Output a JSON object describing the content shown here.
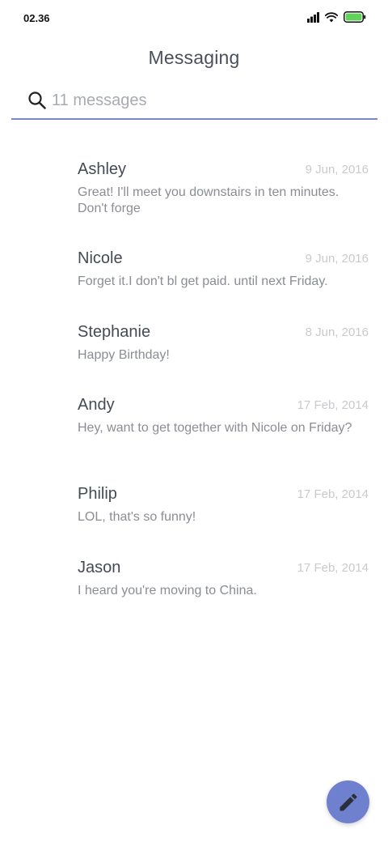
{
  "status_bar": {
    "time": "02.36",
    "signal_icon": "signal-icon",
    "wifi_icon": "wifi-icon",
    "battery_icon": "battery-icon",
    "battery_color": "#5fd35a"
  },
  "header": {
    "title": "Messaging"
  },
  "search": {
    "placeholder": "11 messages",
    "value": "",
    "icon": "search-icon",
    "accent": "#7a89cc"
  },
  "messages": [
    {
      "name": "Ashley",
      "date": "9 Jun, 2016",
      "preview": "Great! I'll meet you downstairs in ten minutes. Don't forge"
    },
    {
      "name": "Nicole",
      "date": "9 Jun, 2016",
      "preview": "Forget it.I don't bl get paid. until next Friday."
    },
    {
      "name": "Stephanie",
      "date": "8 Jun, 2016",
      "preview": "Happy Birthday!"
    },
    {
      "name": "Andy",
      "date": "17 Feb, 2014",
      "preview": "Hey, want to get together with Nicole on Friday?"
    },
    {
      "name": "Philip",
      "date": "17 Feb, 2014",
      "preview": "LOL, that's so funny!"
    },
    {
      "name": "Jason",
      "date": "17 Feb, 2014",
      "preview": "I heard you're moving to China."
    }
  ],
  "fab": {
    "icon": "pencil-icon",
    "color": "#6f80cf"
  }
}
